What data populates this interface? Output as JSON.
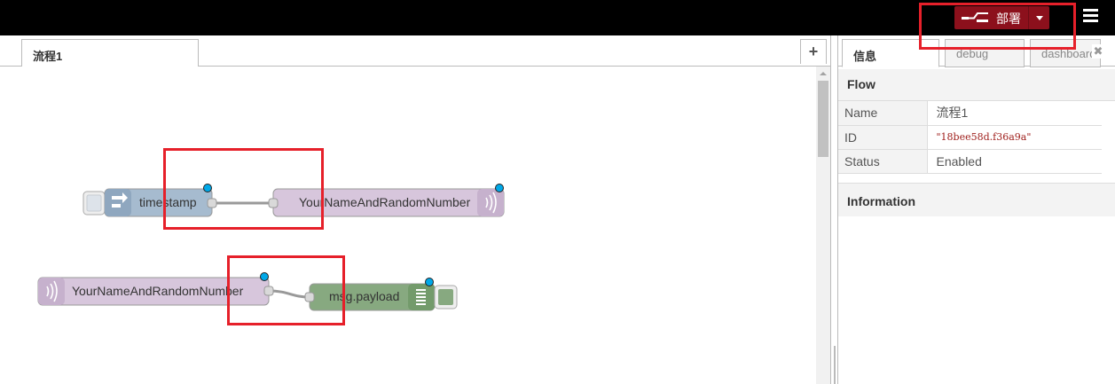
{
  "header": {
    "deploy_label": "部署"
  },
  "workspace": {
    "tab_label": "流程1",
    "add_tab_label": "+"
  },
  "nodes": {
    "inject_label": "timestamp",
    "tts_out_label": "YourNameAndRandomNumber",
    "tts_in_label": "YourNameAndRandomNumber",
    "debug_label": "msg.payload"
  },
  "sidebar": {
    "tabs": [
      "信息",
      "debug",
      "dashboard"
    ],
    "section_flow": "Flow",
    "props": [
      {
        "key": "Name",
        "value": "流程1"
      },
      {
        "key": "ID",
        "value": "\"18bee58d.f36a9a\""
      },
      {
        "key": "Status",
        "value": "Enabled"
      }
    ],
    "section_info": "Information"
  },
  "colors": {
    "deploy_bg": "#8c101c",
    "annotation": "#e6202a",
    "inject_node": "#a6bbcf",
    "audio_node": "#d7c6dc",
    "debug_node": "#87a980"
  }
}
